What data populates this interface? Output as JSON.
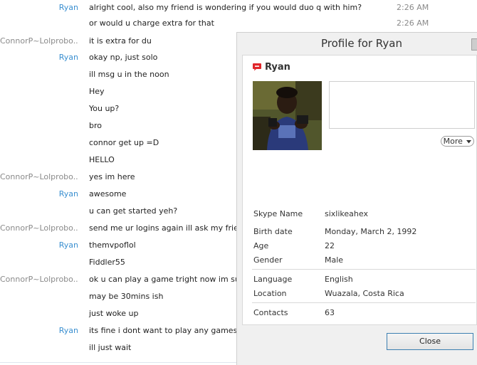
{
  "chat": {
    "messages": [
      {
        "sender": "Ryan",
        "text": "alright cool, also my friend is wondering if you would duo q with him?",
        "time": "2:26 AM"
      },
      {
        "sender": "",
        "text": "or would u charge extra for that",
        "time": "2:26 AM"
      },
      {
        "sender": "ConnorP~Lolprobo...",
        "text": "it is extra for du",
        "time": ""
      },
      {
        "sender": "Ryan",
        "text": "okay np, just solo",
        "time": ""
      },
      {
        "sender": "",
        "text": "ill msg u in the noon",
        "time": ""
      },
      {
        "sender": "",
        "text": "Hey",
        "time": ""
      },
      {
        "sender": "",
        "text": "You up?",
        "time": ""
      },
      {
        "sender": "",
        "text": "bro",
        "time": ""
      },
      {
        "sender": "",
        "text": "connor get up =D",
        "time": ""
      },
      {
        "sender": "",
        "text": "HELLO",
        "time": ""
      },
      {
        "sender": "ConnorP~Lolprobo...",
        "text": "yes im here",
        "time": ""
      },
      {
        "sender": "Ryan",
        "text": "awesome",
        "time": ""
      },
      {
        "sender": "",
        "text": "u can get started yeh?",
        "time": ""
      },
      {
        "sender": "ConnorP~Lolprobo...",
        "text": "send me ur logins again ill ask my friends",
        "time": ""
      },
      {
        "sender": "Ryan",
        "text": "themvpoflol",
        "time": ""
      },
      {
        "sender": "",
        "text": "Fiddler55",
        "time": ""
      },
      {
        "sender": "ConnorP~Lolprobo...",
        "text": "ok u can play a game tright now im sure",
        "time": ""
      },
      {
        "sender": "",
        "text": "may be 30mins ish",
        "time": ""
      },
      {
        "sender": "",
        "text": "just woke up",
        "time": ""
      },
      {
        "sender": "Ryan",
        "text": "its fine i dont want to play any games",
        "time": ""
      },
      {
        "sender": "",
        "text": "ill just wait",
        "time": ""
      }
    ]
  },
  "profile": {
    "window_title": "Profile for Ryan",
    "name": "Ryan",
    "more_label": "More",
    "details": {
      "skype_name_label": "Skype Name",
      "skype_name": "sixlikeahex",
      "birth_date_label": "Birth date",
      "birth_date": "Monday, March 2, 1992",
      "age_label": "Age",
      "age": "22",
      "gender_label": "Gender",
      "gender": "Male",
      "language_label": "Language",
      "language": "English",
      "location_label": "Location",
      "location": "Wuazala, Costa Rica",
      "contacts_label": "Contacts",
      "contacts": "63"
    },
    "close_label": "Close"
  },
  "colors": {
    "ryan_name": "#3a8fd0",
    "connor_name": "#8a8a8a",
    "status_icon": "#e0262a",
    "close_border": "#3c7fb1"
  },
  "icons": {
    "status": "skype-status-icon",
    "more": "chevron-down-icon"
  }
}
